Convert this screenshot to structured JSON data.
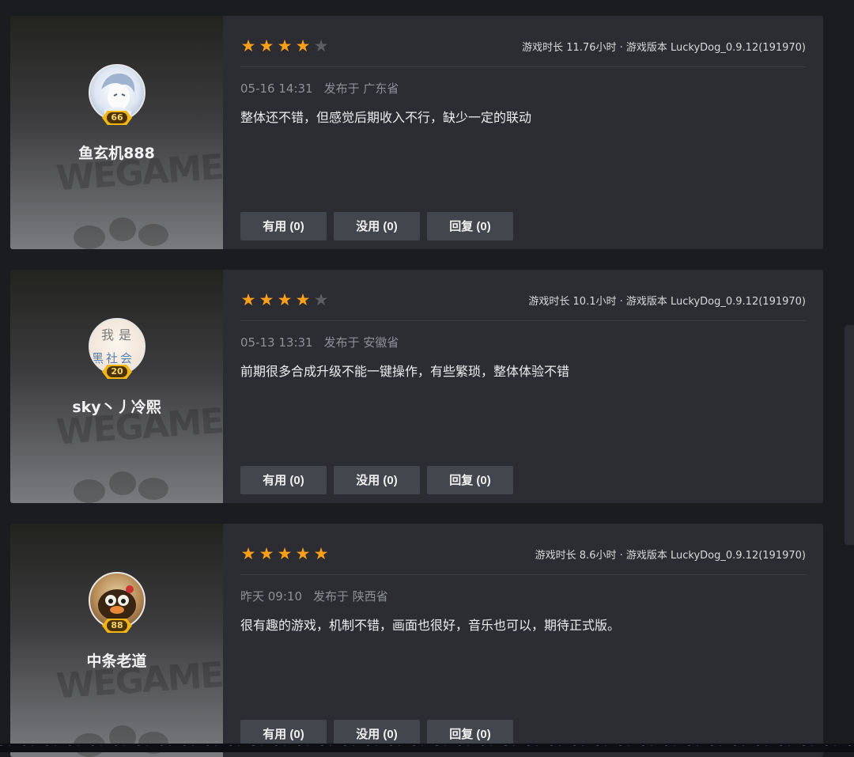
{
  "reviews": [
    {
      "username": "鱼玄机888",
      "level": "66",
      "rating": 4,
      "play_info": "游戏时长 11.76小时 · 游戏版本 LuckyDog_0.9.12(191970)",
      "date": "05-16 14:31",
      "location": "发布于 广东省",
      "text": "整体还不错，但感觉后期收入不行，缺少一定的联动",
      "useful_label": "有用 (0)",
      "useless_label": "没用 (0)",
      "reply_label": "回复 (0)"
    },
    {
      "username": "sky丶丿冷熙",
      "level": "20",
      "rating": 4,
      "play_info": "游戏时长 10.1小时 · 游戏版本 LuckyDog_0.9.12(191970)",
      "date": "05-13 13:31",
      "location": "发布于 安徽省",
      "text": "前期很多合成升级不能一键操作，有些繁琐，整体体验不错",
      "useful_label": "有用 (0)",
      "useless_label": "没用 (0)",
      "reply_label": "回复 (0)"
    },
    {
      "username": "中条老道",
      "level": "88",
      "rating": 5,
      "play_info": "游戏时长 8.6小时 · 游戏版本 LuckyDog_0.9.12(191970)",
      "date": "昨天 09:10",
      "location": "发布于 陕西省",
      "text": "很有趣的游戏，机制不错，画面也很好，音乐也可以，期待正式版。",
      "useful_label": "有用 (0)",
      "useless_label": "没用 (0)",
      "reply_label": "回复 (0)"
    }
  ],
  "avatar_texts": [
    "我是",
    "黑社会"
  ],
  "watermark_text": "WEGAME",
  "colors": {
    "star_on": "#ff9f1a",
    "star_off": "#5c5e63",
    "card_bg": "#2b2d33",
    "button_bg": "#43464d",
    "badge": "#f3b612"
  },
  "icons": {
    "star": "star-icon",
    "level": "level-badge-icon"
  }
}
